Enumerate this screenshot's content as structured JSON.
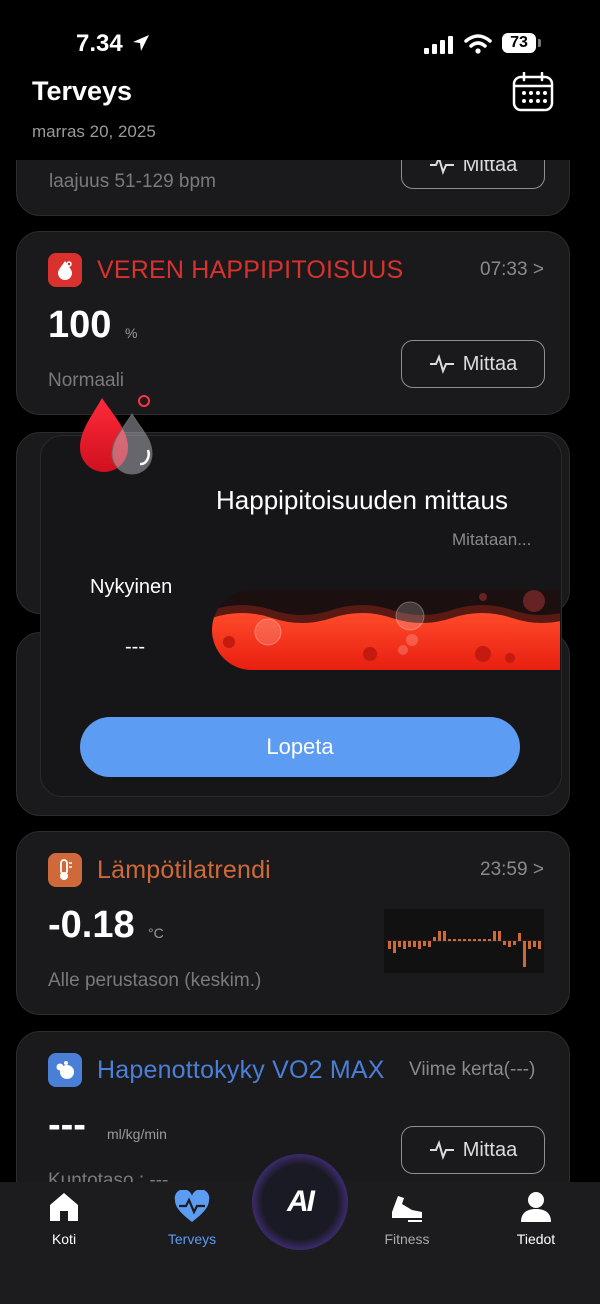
{
  "status": {
    "time": "7.34",
    "battery": "73"
  },
  "header": {
    "title": "Terveys",
    "date": "marras 20, 2025"
  },
  "heart_card": {
    "range": "laajuus 51-129 bpm",
    "measure_label": "Mittaa"
  },
  "spo2_card": {
    "title": "VEREN HAPPIPITOISUUS",
    "time": "07:33 >",
    "value": "100",
    "unit": "%",
    "status": "Normaali",
    "measure_label": "Mittaa",
    "accent": "#d9322e"
  },
  "modal": {
    "title": "Happipitoisuuden mittaus",
    "subtitle": "Mitataan...",
    "current_label": "Nykyinen",
    "current_value": "---",
    "stop_label": "Lopeta",
    "button_color": "#5c9cf2"
  },
  "temp_card": {
    "title": "Lämpötilatrendi",
    "time": "23:59 >",
    "value": "-0.18",
    "unit": "°C",
    "status": "Alle perustason (keskim.)",
    "accent": "#d0693a"
  },
  "vo2_card": {
    "title": "Hapenottokyky VO2 MAX",
    "time": "Viime kerta(---)",
    "value": "---",
    "unit": "ml/kg/min",
    "status": "Kuntotaso : ---",
    "measure_label": "Mittaa",
    "accent": "#4a7fd8"
  },
  "tabs": [
    {
      "label": "Koti",
      "icon": "home-icon"
    },
    {
      "label": "Terveys",
      "icon": "heart-pulse-icon"
    },
    {
      "label": "AI",
      "icon": "ai-icon"
    },
    {
      "label": "Fitness",
      "icon": "shoe-icon"
    },
    {
      "label": "Tiedot",
      "icon": "person-icon"
    }
  ],
  "tab_active_color": "#5c9cf2"
}
